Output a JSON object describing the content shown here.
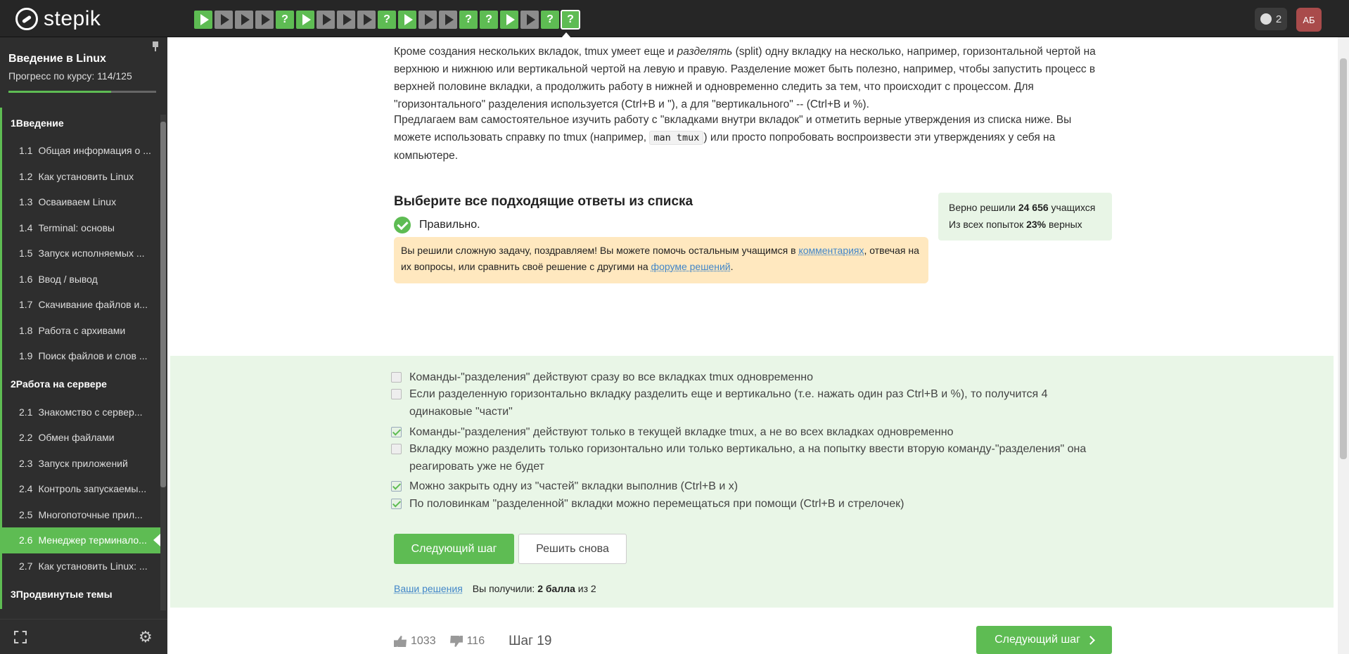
{
  "header": {
    "logo_text": "stepik",
    "notifications_count": "2",
    "avatar_initials": "АБ",
    "steps": [
      {
        "type": "theory",
        "done": true
      },
      {
        "type": "theory",
        "done": false
      },
      {
        "type": "theory",
        "done": false
      },
      {
        "type": "theory",
        "done": false
      },
      {
        "type": "quiz",
        "done": true,
        "glyph": "?"
      },
      {
        "type": "video",
        "done": true
      },
      {
        "type": "theory",
        "done": false
      },
      {
        "type": "theory",
        "done": false
      },
      {
        "type": "theory",
        "done": false
      },
      {
        "type": "quiz",
        "done": true,
        "glyph": "?"
      },
      {
        "type": "video",
        "done": true
      },
      {
        "type": "theory",
        "done": false
      },
      {
        "type": "theory",
        "done": false
      },
      {
        "type": "quiz",
        "done": true,
        "glyph": "?"
      },
      {
        "type": "quiz",
        "done": true,
        "glyph": "?"
      },
      {
        "type": "video",
        "done": true
      },
      {
        "type": "theory",
        "done": false
      },
      {
        "type": "quiz",
        "done": true,
        "glyph": "?"
      },
      {
        "type": "quiz",
        "done": true,
        "glyph": "?",
        "current": true
      }
    ]
  },
  "sidebar": {
    "course_title": "Введение в Linux",
    "progress_label": "Прогресс по курсу:",
    "progress_value": "114/125",
    "progress_fraction": 0.912,
    "toc": [
      {
        "kind": "section",
        "num": "1",
        "label": "Введение"
      },
      {
        "kind": "lesson",
        "num": "1.1",
        "label": "Общая информация о ..."
      },
      {
        "kind": "lesson",
        "num": "1.2",
        "label": "Как установить Linux"
      },
      {
        "kind": "lesson",
        "num": "1.3",
        "label": "Осваиваем Linux"
      },
      {
        "kind": "lesson",
        "num": "1.4",
        "label": "Terminal: основы"
      },
      {
        "kind": "lesson",
        "num": "1.5",
        "label": "Запуск исполняемых ..."
      },
      {
        "kind": "lesson",
        "num": "1.6",
        "label": "Ввод / вывод"
      },
      {
        "kind": "lesson",
        "num": "1.7",
        "label": "Скачивание файлов и..."
      },
      {
        "kind": "lesson",
        "num": "1.8",
        "label": "Работа с архивами"
      },
      {
        "kind": "lesson",
        "num": "1.9",
        "label": "Поиск файлов и слов ..."
      },
      {
        "kind": "section",
        "num": "2",
        "label": "Работа на сервере"
      },
      {
        "kind": "lesson",
        "num": "2.1",
        "label": "Знакомство с сервер..."
      },
      {
        "kind": "lesson",
        "num": "2.2",
        "label": "Обмен файлами"
      },
      {
        "kind": "lesson",
        "num": "2.3",
        "label": "Запуск приложений"
      },
      {
        "kind": "lesson",
        "num": "2.4",
        "label": "Контроль запускаемы..."
      },
      {
        "kind": "lesson",
        "num": "2.5",
        "label": "Многопоточные прил..."
      },
      {
        "kind": "lesson",
        "num": "2.6",
        "label": "Менеджер терминало...",
        "active": true
      },
      {
        "kind": "lesson",
        "num": "2.7",
        "label": "Как установить Linux: ..."
      },
      {
        "kind": "section",
        "num": "3",
        "label": "Продвинутые темы"
      }
    ]
  },
  "content": {
    "para1_a": "Кроме создания нескольких вкладок, tmux умеет еще и ",
    "para1_em": "разделять",
    "para1_b": " (split) одну вкладку на несколько, например, горизонтальной чертой на верхнюю и нижнюю или вертикальной чертой на левую и правую. Разделение может быть полезно, например, чтобы запустить процесс в верхней половине вкладки, а продолжить работу в нижней и одновременно следить за тем, что происходит с процессом. Для \"горизонтального\" разделения используется (Ctrl+B и \"), а для \"вертикального\" -- (Ctrl+B и %).",
    "para2_a": "Предлагаем вам самостоятельное изучить работу с \"вкладками внутри вкладок\" и отметить верные утверждения из списка ниже. Вы можете использовать справку по tmux (например, ",
    "para2_code": "man tmux",
    "para2_b": ") или просто попробовать воспроизвести эти утверждениях у себя на компьютере."
  },
  "quiz": {
    "title": "Выберите все подходящие ответы из списка",
    "status": "Правильно.",
    "congrats_a": "Вы решили сложную задачу, поздравляем! Вы можете помочь остальным учащимся в ",
    "congrats_link1": "комментариях",
    "congrats_b": ", отвечая на их вопросы, или сравнить своё решение с другими на ",
    "congrats_link2": "форуме решений",
    "congrats_c": ".",
    "stats_line1_a": "Верно решили ",
    "stats_line1_b": "24 656",
    "stats_line1_c": " учащихся",
    "stats_line2_a": "Из всех попыток ",
    "stats_line2_b": "23%",
    "stats_line2_c": " верных",
    "options": [
      {
        "text": "Команды-\"разделения\" действуют сразу во все вкладках tmux одновременно",
        "checked": false
      },
      {
        "text": "Если разделенную горизонтально вкладку разделить еще и вертикально (т.е. нажать один раз Ctrl+B и %), то получится 4 одинаковые \"части\"",
        "checked": false
      },
      {
        "text": "Команды-\"разделения\" действуют только в текущей вкладке tmux, а не во всех вкладках одновременно",
        "checked": true
      },
      {
        "text": "Вкладку можно разделить только горизонтально или только вертикально, а на попытку ввести вторую команду-\"разделения\" она реагировать уже не будет",
        "checked": false
      },
      {
        "text": "Можно закрыть одну из \"частей\" вкладки выполнив (Ctrl+B и x)",
        "checked": true
      },
      {
        "text": "По половинкам \"разделенной\" вкладки можно перемещаться при помощи (Ctrl+B и стрелочек)",
        "checked": true
      }
    ],
    "next_button": "Следующий шаг",
    "retry_button": "Решить снова",
    "solutions_link": "Ваши решения",
    "score_a": "Вы получили: ",
    "score_b": "2 балла",
    "score_c": " из 2"
  },
  "footer": {
    "likes": "1033",
    "dislikes": "116",
    "step_label": "Шаг 19",
    "next_button": "Следующий шаг"
  },
  "colors": {
    "accent": "#5ebc53",
    "topbar": "#262626",
    "sidebar": "#2e2e2e",
    "answer_bg": "#e9f6e7",
    "congrats_bg": "#ffe8bf",
    "link": "#4286c8"
  }
}
